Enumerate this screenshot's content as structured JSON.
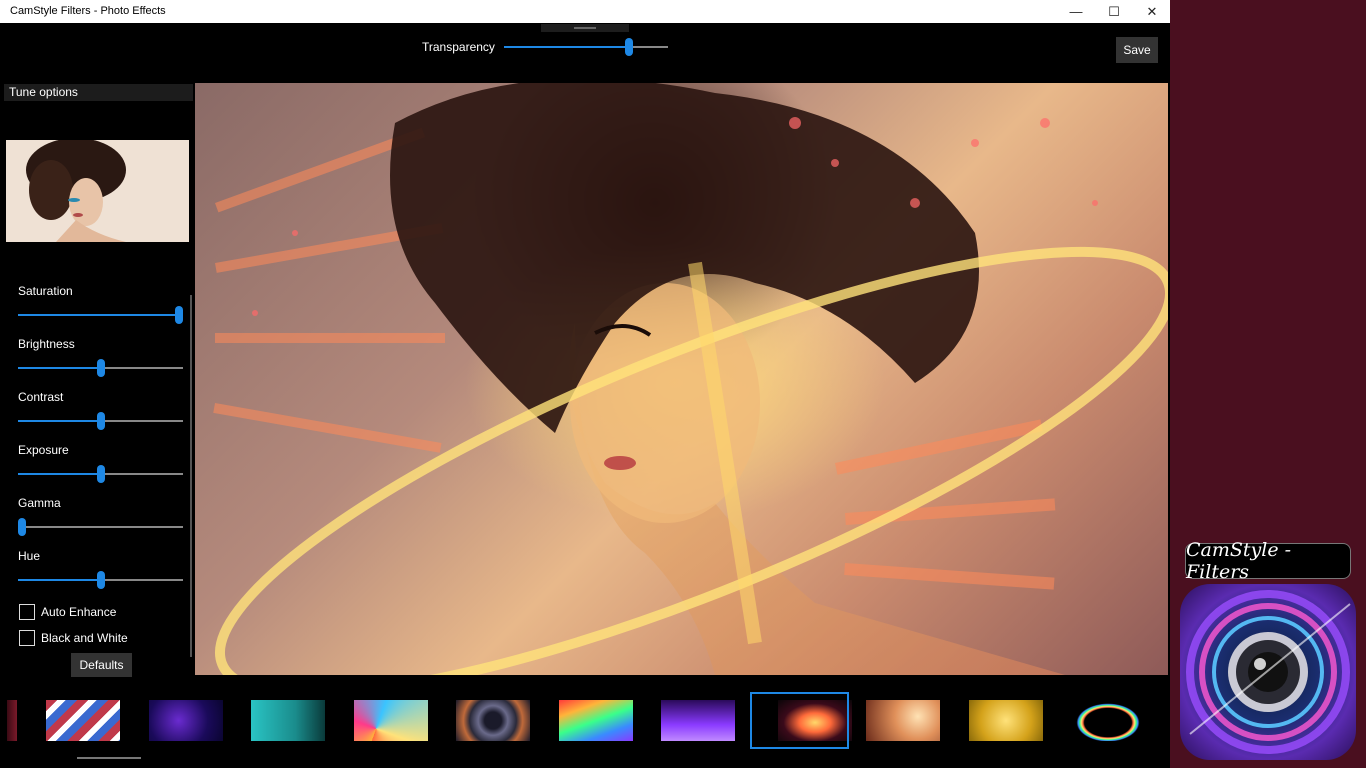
{
  "window": {
    "title": "CamStyle Filters - Photo Effects",
    "minimize_glyph": "—",
    "maximize_glyph": "☐",
    "close_glyph": "✕"
  },
  "toolbar": {
    "transparency_label": "Transparency",
    "transparency_value": 0.76,
    "save_label": "Save"
  },
  "tune": {
    "header": "Tune options",
    "adjustments": [
      {
        "label": "Saturation",
        "value": 1.0
      },
      {
        "label": "Brightness",
        "value": 0.5
      },
      {
        "label": "Contrast",
        "value": 0.5
      },
      {
        "label": "Exposure",
        "value": 0.5
      },
      {
        "label": "Gamma",
        "value": 0.0
      },
      {
        "label": "Hue",
        "value": 0.5
      }
    ],
    "checkboxes": [
      {
        "label": "Auto Enhance",
        "checked": false
      },
      {
        "label": "Black and White",
        "checked": false
      }
    ],
    "defaults_label": "Defaults"
  },
  "filters": {
    "selected_index": 7,
    "items": [
      {
        "name": "stripes-red-white-blue"
      },
      {
        "name": "blue-purple-lights"
      },
      {
        "name": "teal-glow"
      },
      {
        "name": "light-rays"
      },
      {
        "name": "smoky-ring"
      },
      {
        "name": "rainbow-streaks"
      },
      {
        "name": "purple-beams"
      },
      {
        "name": "clock-light-ring"
      },
      {
        "name": "warm-bokeh"
      },
      {
        "name": "gold-glitter"
      },
      {
        "name": "rainbow-ring"
      }
    ]
  },
  "promo": {
    "title": "CamStyle - Filters"
  },
  "colors": {
    "accent": "#1e88e5",
    "app_background": "#000000",
    "desktop_background": "#4a0f1f"
  }
}
